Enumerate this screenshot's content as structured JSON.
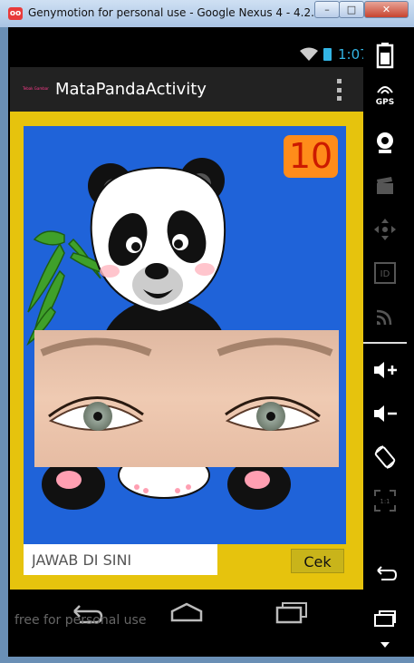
{
  "window": {
    "title": "Genymotion for personal use - Google Nexus 4 - 4.2.2 - A...",
    "icon_text": "oo",
    "minimize": "–",
    "maximize": "□",
    "close": "✕"
  },
  "statusbar": {
    "time": "1:07",
    "wifi_icon": "wifi-icon",
    "battery_icon": "battery-icon"
  },
  "actionbar": {
    "title": "MataPandaActivity",
    "app_icon_text": "Tebak Gambar"
  },
  "game": {
    "counter": "10"
  },
  "answer": {
    "placeholder": "JAWAB DI SINI",
    "value": ""
  },
  "check_button": "Cek",
  "watermark": "free for personal use",
  "side_panel": {
    "gps_label": "GPS"
  },
  "colors": {
    "panel_blue": "#1f63d9",
    "frame_yellow": "#e6c30d",
    "counter_orange": "#ff8c1a",
    "accent": "#33b5e5"
  }
}
